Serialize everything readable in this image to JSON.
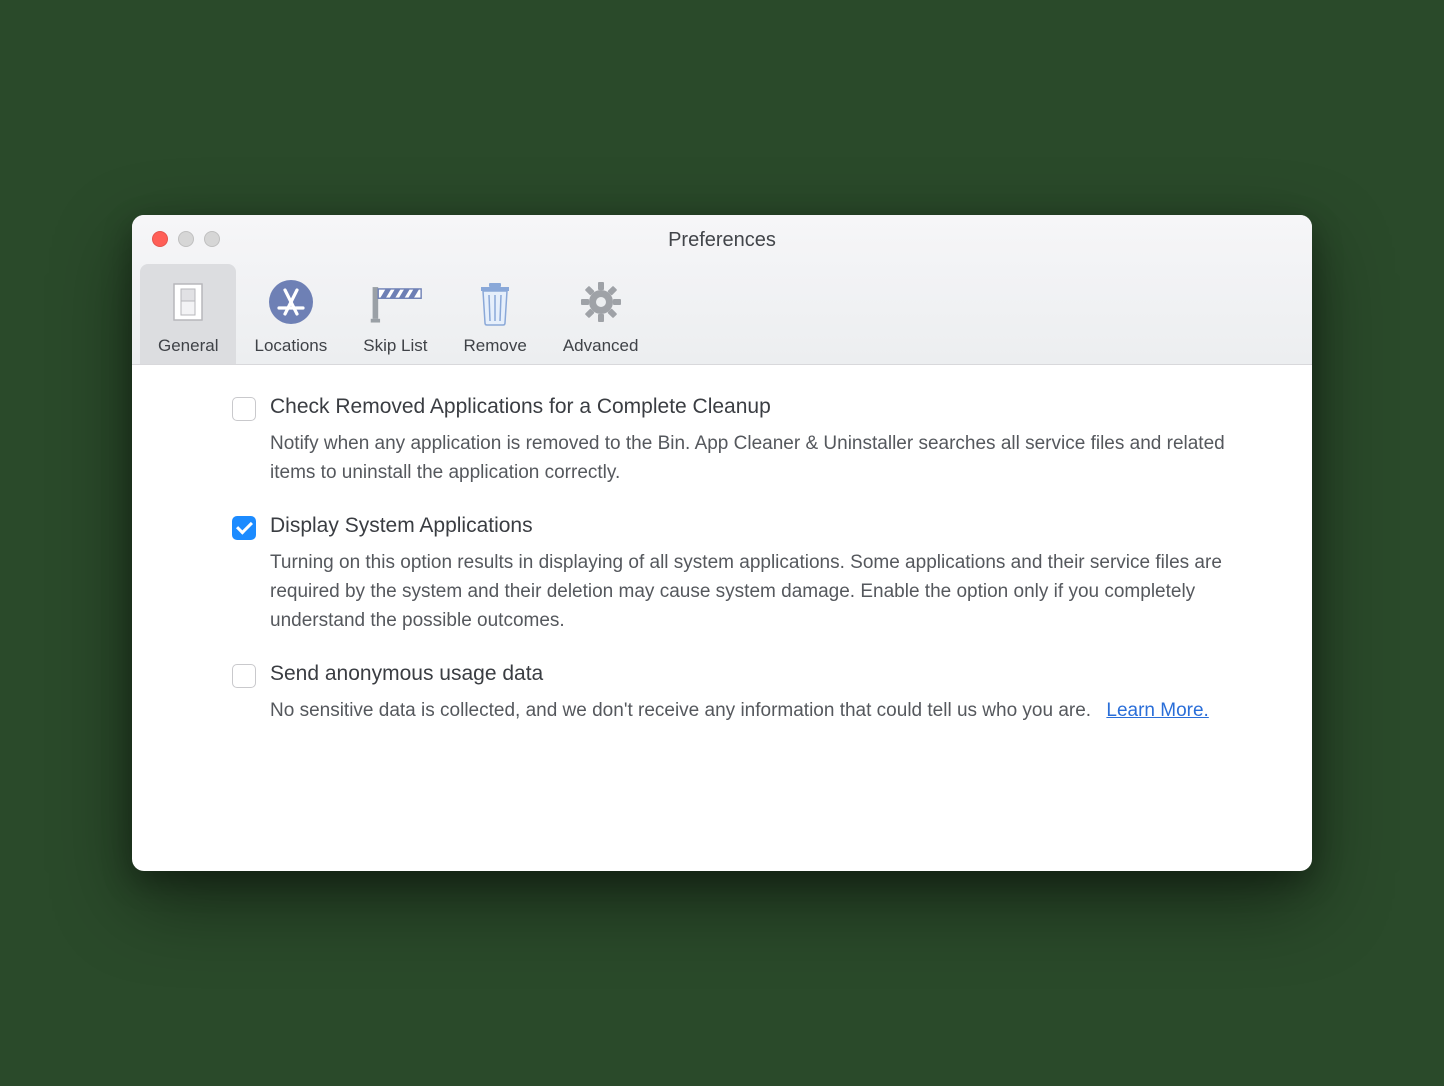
{
  "window": {
    "title": "Preferences"
  },
  "toolbar": {
    "items": [
      {
        "label": "General"
      },
      {
        "label": "Locations"
      },
      {
        "label": "Skip List"
      },
      {
        "label": "Remove"
      },
      {
        "label": "Advanced"
      }
    ]
  },
  "options": {
    "check_removed": {
      "title": "Check Removed Applications for a Complete Cleanup",
      "desc": "Notify when any application is removed to the Bin. App Cleaner & Uninstaller searches all service files and related items to uninstall the application correctly."
    },
    "display_system": {
      "title": "Display System Applications",
      "desc": "Turning on this option results in displaying of all system applications. Some applications and their service files are required by the system and their deletion may cause system damage. Enable the option only if you completely understand the possible outcomes."
    },
    "send_usage": {
      "title": "Send anonymous usage data",
      "desc": "No sensitive data is collected, and we don't receive any information that could tell us who you are.",
      "link": "Learn More."
    }
  }
}
